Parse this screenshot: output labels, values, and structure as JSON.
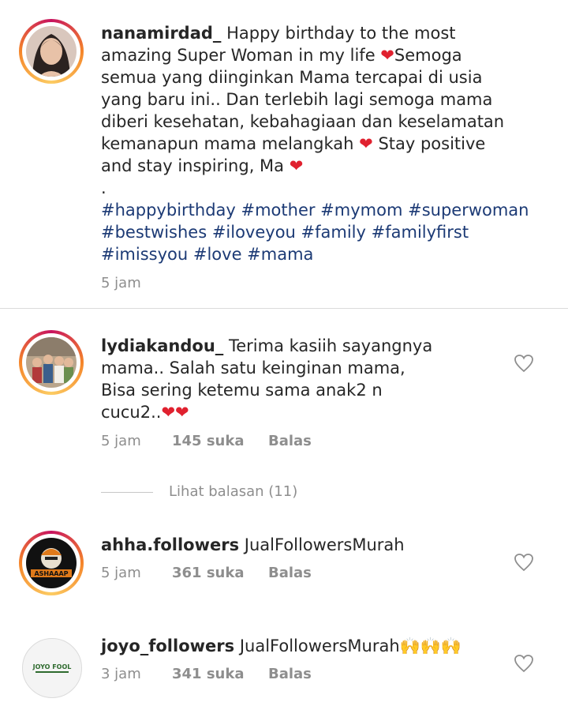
{
  "caption": {
    "username": "nanamirdad_",
    "lines": [
      " Happy birthday to the most",
      "amazing Super Woman in my life ",
      "Semoga",
      "semua yang diinginkan Mama tercapai di usia",
      "yang baru ini.. Dan terlebih lagi semoga mama",
      "diberi kesehatan, kebahagiaan dan keselamatan",
      "kemanapun mama melangkah ",
      " Stay positive",
      "and stay inspiring, Ma ",
      "."
    ],
    "hashtag_lines": [
      "#happybirthday #mother #mymom #superwoman",
      "#bestwishes #iloveyou #family #familyfirst",
      "#imissyou #love #mama"
    ],
    "time": "5 jam",
    "heart_emoji": "❤️"
  },
  "comments": [
    {
      "username": "lydiakandou_",
      "lines": [
        " Terima kasiih sayangnya",
        "mama.. Salah satu keinginan mama,",
        "Bisa sering ketemu sama anak2 n",
        "cucu2.."
      ],
      "emoji": "❤❤",
      "time": "5 jam",
      "likes": "145 suka",
      "reply": "Balas"
    },
    {
      "username": "ahha.followers",
      "text": " JualFollowersMurah",
      "time": "5 jam",
      "likes": "361 suka",
      "reply": "Balas",
      "avatar_text": "ASHAAAP"
    },
    {
      "username": "joyo_followers",
      "text": " JualFollowersMurah",
      "emoji": "🙌🙌🙌",
      "time": "3 jam",
      "likes": "341 suka",
      "reply": "Balas",
      "avatar_text": "JOYO FOOL"
    }
  ],
  "view_replies": "Lihat balasan (11)",
  "colors": {
    "text": "#262626",
    "muted": "#8e8e8e",
    "hashtag": "#1c3a75",
    "heart": "#e0212f"
  }
}
